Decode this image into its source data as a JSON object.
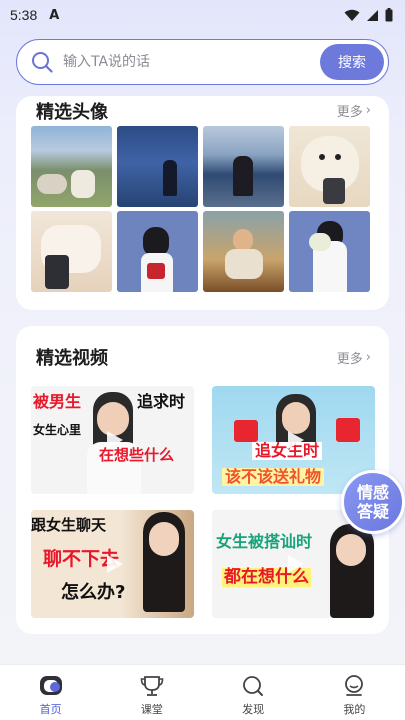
{
  "status_bar": {
    "time": "5:38",
    "app_indicator": "A"
  },
  "search": {
    "placeholder": "输入TA说的话",
    "button_label": "搜索"
  },
  "avatars_section": {
    "title": "精选头像",
    "more_label": "更多",
    "items": [
      {
        "subject": "cattle-on-grassland-photo"
      },
      {
        "subject": "figure-at-dusk-lake-photo"
      },
      {
        "subject": "girl-by-seaside-photo"
      },
      {
        "subject": "dog-with-phone-photo"
      },
      {
        "subject": "plush-toy-with-phone-photo"
      },
      {
        "subject": "girl-with-flowers-illustration"
      },
      {
        "subject": "oil-painting-illustration"
      },
      {
        "subject": "figure-holding-flowers-illustration"
      }
    ]
  },
  "videos_section": {
    "title": "精选视频",
    "more_label": "更多",
    "items": [
      {
        "captions": [
          "被男生",
          "追求时",
          "女生心里",
          "在想些什么"
        ]
      },
      {
        "captions": [
          "追女生时",
          "该不该送礼物"
        ]
      },
      {
        "captions": [
          "跟女生聊天",
          "聊不下去",
          "怎么办?"
        ]
      },
      {
        "captions": [
          "女生被搭讪时",
          "都在想什么"
        ]
      }
    ]
  },
  "floating_button": {
    "line1": "情感",
    "line2": "答疑"
  },
  "tabbar": {
    "items": [
      {
        "label": "首页",
        "active": true
      },
      {
        "label": "课堂",
        "active": false
      },
      {
        "label": "发现",
        "active": false
      },
      {
        "label": "我的",
        "active": false
      }
    ]
  },
  "colors": {
    "accent": "#6e79dc",
    "active_tab": "#4f5bd5",
    "card_bg": "#ffffff"
  }
}
